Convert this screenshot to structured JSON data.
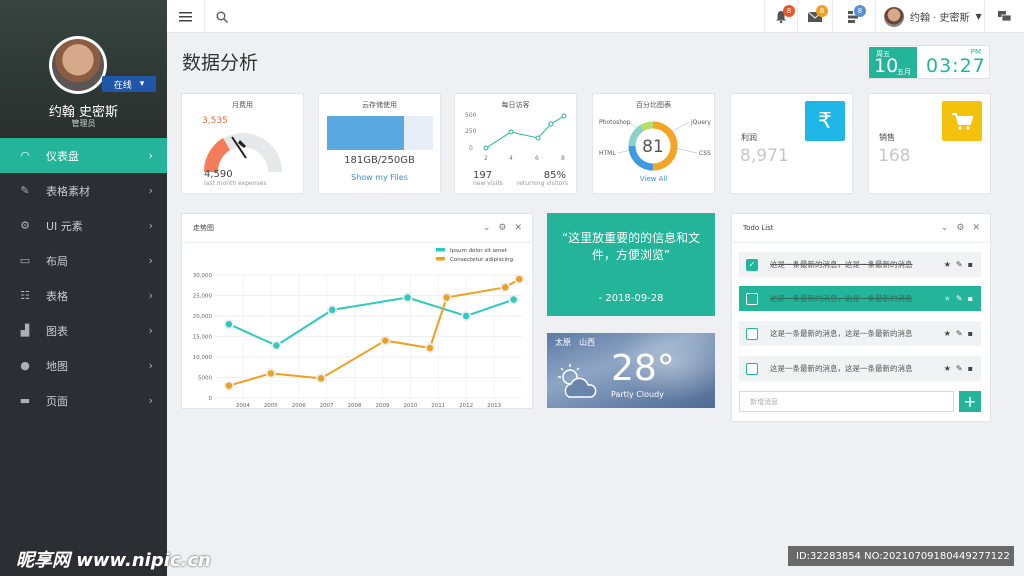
{
  "colors": {
    "accent": "#23b49a",
    "sidebar": "#2b2f33",
    "blue": "#5aa8e0",
    "orange": "#f0a020",
    "cyan": "#1fb6e8",
    "yellow": "#f4c20d"
  },
  "sidebar": {
    "user_name": "约翰 史密斯",
    "user_role": "管理员",
    "status": "在线",
    "items": [
      {
        "label": "仪表盘",
        "icon": "dashboard-icon"
      },
      {
        "label": "表格素材",
        "icon": "pencil-icon"
      },
      {
        "label": "UI 元素",
        "icon": "gear-icon"
      },
      {
        "label": "布局",
        "icon": "monitor-icon"
      },
      {
        "label": "表格",
        "icon": "table-icon"
      },
      {
        "label": "图表",
        "icon": "bar-chart-icon"
      },
      {
        "label": "地图",
        "icon": "map-marker-icon"
      },
      {
        "label": "页面",
        "icon": "folder-icon"
      }
    ]
  },
  "topbar": {
    "notifications_count": "8",
    "messages_count": "8",
    "tasks_count": "8",
    "user_label": "约翰 · 史密斯"
  },
  "page": {
    "title": "数据分析"
  },
  "datebox": {
    "weekday": "周五",
    "day": "10",
    "month": "五月",
    "time": "03:27",
    "ampm": "PM"
  },
  "cards": {
    "monthly": {
      "title": "月费用",
      "value": "3,535",
      "amount": "4,590",
      "caption": "last month expenses"
    },
    "storage": {
      "title": "云存储使用",
      "usage": "181GB/250GB",
      "link": "Show my Files",
      "fraction": 0.724
    },
    "visits": {
      "title": "每日访客",
      "yticks": [
        "500",
        "250",
        "0"
      ],
      "xticks": [
        "2",
        "4",
        "6",
        "8"
      ],
      "new": "197",
      "new_label": "new visits",
      "returning": "85%",
      "returning_label": "returning visitors"
    },
    "percent": {
      "title": "百分比图表",
      "center": "81",
      "labels": [
        "Photoshop",
        "jQuery",
        "HTML",
        "CSS"
      ],
      "link": "View All"
    },
    "profit": {
      "title": "利润",
      "value": "8,971",
      "icon": "rupee-icon"
    },
    "sales": {
      "title": "销售",
      "value": "168",
      "icon": "shopping-cart-icon"
    }
  },
  "trend": {
    "title": "走势图",
    "legend": [
      "Ipsum dolor sit amet",
      "Consectetur adipiscing."
    ]
  },
  "chart_data": {
    "type": "line",
    "categories": [
      "2004",
      "2005",
      "2006",
      "2007",
      "2008",
      "2009",
      "2010",
      "2011",
      "2012",
      "2013"
    ],
    "ylim": [
      0,
      30000
    ],
    "yticks": [
      "30,000",
      "25,000",
      "20,000",
      "15,000",
      "10,000",
      "5000",
      "0"
    ],
    "xlabel": "",
    "ylabel": "",
    "series": [
      {
        "name": "Ipsum dolor sit amet",
        "color": "#2ec9bd",
        "x": [
          2003.5,
          2005.2,
          2007.2,
          2009.9,
          2012.0,
          2013.7
        ],
        "values": [
          18000,
          12800,
          21500,
          24500,
          20000,
          24000
        ]
      },
      {
        "name": "Consectetur adipiscing.",
        "color": "#f0a020",
        "x": [
          2003.5,
          2005.0,
          2006.8,
          2009.1,
          2010.7,
          2011.3,
          2013.4,
          2013.9
        ],
        "values": [
          3000,
          6000,
          4800,
          14000,
          12200,
          24500,
          27000,
          29000
        ]
      }
    ]
  },
  "quote": {
    "text": "“这里放重要的的信息和文件，方便浏览”",
    "date": "- 2018-09-28"
  },
  "weather": {
    "city": "太原　山西",
    "temp": "28°",
    "condition": "Partly Cloudy",
    "icon": "partly-cloudy-icon"
  },
  "todo": {
    "title": "Todo List",
    "items": [
      {
        "text": "这是一条最新的消息，这是一条最新的消息",
        "checked": true,
        "highlight": false
      },
      {
        "text": "这是一条最新的消息，这是一条最新的消息",
        "checked": false,
        "highlight": true
      },
      {
        "text": "这是一条最新的消息，这是一条最新的消息",
        "checked": false,
        "highlight": false
      },
      {
        "text": "这是一条最新的消息，这是一条最新的消息",
        "checked": false,
        "highlight": false
      }
    ],
    "placeholder": "新增消息"
  },
  "watermark": {
    "text": "昵享网 www.nipic.cn",
    "id": "ID:32283854 NO:20210709180449277122"
  }
}
